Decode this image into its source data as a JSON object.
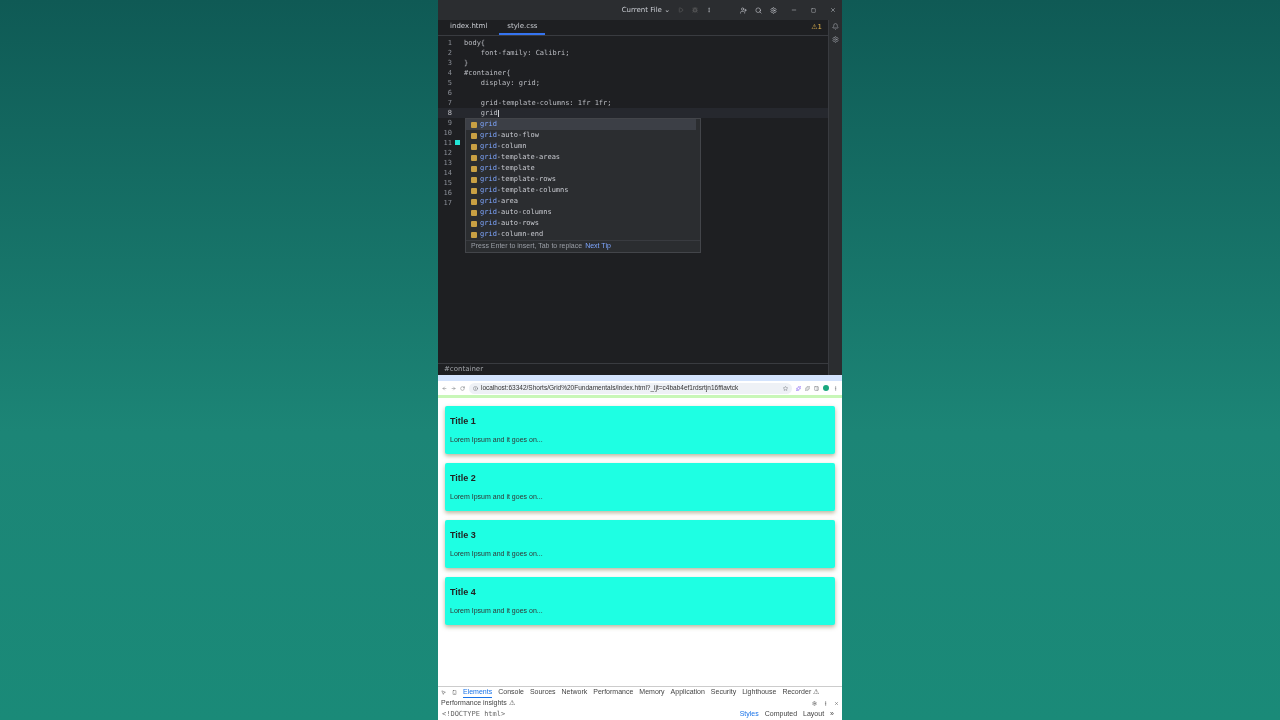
{
  "ide": {
    "run_config": "Current File ⌄",
    "tabs": [
      {
        "label": "index.html",
        "selected": false
      },
      {
        "label": "style.css",
        "selected": true
      }
    ],
    "warnings": "⚠1",
    "lines": [
      {
        "number": "1",
        "text": "body{",
        "current": false
      },
      {
        "number": "2",
        "text": "    font-family: Calibri;",
        "current": false
      },
      {
        "number": "3",
        "text": "}",
        "current": false
      },
      {
        "number": "4",
        "text": "#container{",
        "current": false
      },
      {
        "number": "5",
        "text": "    display: grid;",
        "current": false
      },
      {
        "number": "6",
        "current": false
      },
      {
        "number": "7",
        "text": "    grid-template-columns: 1fr 1fr;",
        "current": false
      },
      {
        "number": "8",
        "text": "    grid",
        "current": true
      },
      {
        "number": "9",
        "current": false
      },
      {
        "number": "10",
        "current": false
      },
      {
        "number": "11",
        "current": false
      },
      {
        "number": "12",
        "current": false
      },
      {
        "number": "13",
        "current": false
      },
      {
        "number": "14",
        "current": false
      },
      {
        "number": "15",
        "current": false
      },
      {
        "number": "16",
        "current": false
      },
      {
        "number": "17",
        "current": false
      }
    ],
    "completion": {
      "items": [
        {
          "match": "grid",
          "selected": true
        },
        {
          "match": "grid",
          "rest": "-auto-flow",
          "selected": false
        },
        {
          "match": "grid",
          "rest": "-column",
          "selected": false
        },
        {
          "match": "grid",
          "rest": "-template-areas",
          "selected": false
        },
        {
          "match": "grid",
          "rest": "-template",
          "selected": false
        },
        {
          "match": "grid",
          "rest": "-template-rows",
          "selected": false
        },
        {
          "match": "grid",
          "rest": "-template-columns",
          "selected": false
        },
        {
          "match": "grid",
          "rest": "-area",
          "selected": false
        },
        {
          "match": "grid",
          "rest": "-auto-columns",
          "selected": false
        },
        {
          "match": "grid",
          "rest": "-auto-rows",
          "selected": false
        },
        {
          "match": "grid",
          "rest": "-column-end",
          "selected": false
        }
      ],
      "hint": "Press Enter to insert, Tab to replace",
      "tip_link": "Next Tip"
    },
    "breadcrumb": "#container"
  },
  "browser": {
    "url": "localhost:63342/Shorts/Grid%20Fundamentals/index.html?_ijt=c4bab4ef1rdsrtjn16ffiavtck",
    "cards": [
      {
        "title": "Title 1",
        "text": "Lorem Ipsum and it goes on..."
      },
      {
        "title": "Title 2",
        "text": "Lorem Ipsum and it goes on..."
      },
      {
        "title": "Title 3",
        "text": "Lorem Ipsum and it goes on..."
      },
      {
        "title": "Title 4",
        "text": "Lorem Ipsum and it goes on..."
      }
    ],
    "devtools": {
      "tabs": [
        {
          "label": "Elements",
          "selected": true
        },
        {
          "label": "Console",
          "selected": false
        },
        {
          "label": "Sources",
          "selected": false
        },
        {
          "label": "Network",
          "selected": false
        },
        {
          "label": "Performance",
          "selected": false
        },
        {
          "label": "Memory",
          "selected": false
        },
        {
          "label": "Application",
          "selected": false
        },
        {
          "label": "Security",
          "selected": false
        },
        {
          "label": "Lighthouse",
          "selected": false
        },
        {
          "label": "Recorder ⚠",
          "selected": false
        },
        {
          "label": "Performance insights ⚠",
          "selected": false
        }
      ],
      "dom_line": "<!DOCTYPE html>",
      "side_tabs": [
        {
          "label": "Styles",
          "selected": true
        },
        {
          "label": "Computed",
          "selected": false
        },
        {
          "label": "Layout",
          "selected": false
        },
        {
          "label": "»",
          "selected": false
        }
      ]
    }
  }
}
